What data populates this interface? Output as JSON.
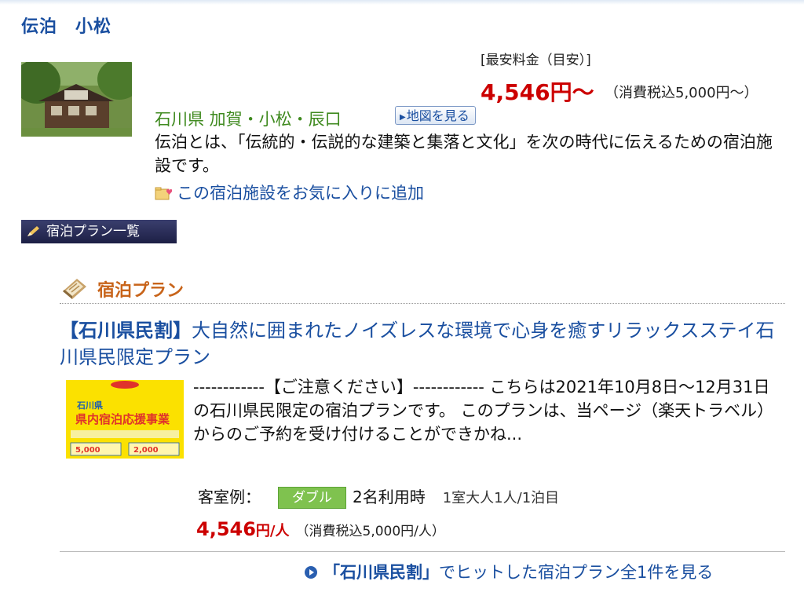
{
  "hotel": {
    "name": "伝泊　小松",
    "price_label": "[最安料金（目安）]",
    "price": "4,546円〜",
    "price_tax": "（消費税込5,000円〜）",
    "area": "石川県 加賀・小松・辰口",
    "map_button": "地図を見る",
    "description": "伝泊とは、「伝統的・伝説的な建築と集落と文化」を次の時代に伝えるための宿泊施設です。",
    "favorite_link": "この宿泊施設をお気に入りに追加"
  },
  "plan_list_button": "宿泊プラン一覧",
  "section": {
    "title": "宿泊プラン"
  },
  "plan": {
    "title_bracket": "【石川県民割】",
    "title_rest": "大自然に囲まれたノイズレスな環境で心身を癒すリラックスステイ石川県民限定プラン",
    "description": "------------【ご注意ください】------------ こちらは2021年10月8日〜12月31日の石川県民限定の宿泊プランです。 このプランは、当ページ（楽天トラベル）からのご予約を受け付けることができかね...",
    "image_text": {
      "top": "石川県",
      "headline": "県内宿泊応援事業",
      "price_a": "5,000",
      "price_b": "2,000"
    },
    "room_label": "客室例：",
    "room_type": "ダブル",
    "occupancy": "2名利用時",
    "occupancy_detail": "1室大人1人/1泊目",
    "price_num": "4,546",
    "price_unit": "円/人",
    "price_tax": "（消費税込5,000円/人）"
  },
  "more_link": {
    "keyword": "「石川県民割」",
    "rest": "でヒットした宿泊プラン全1件を見る"
  },
  "colors": {
    "link_blue": "#1a4fa0",
    "price_red": "#cc0000",
    "area_green": "#3f8a1f",
    "section_orange": "#c8641a",
    "badge_green": "#7fc24f"
  }
}
